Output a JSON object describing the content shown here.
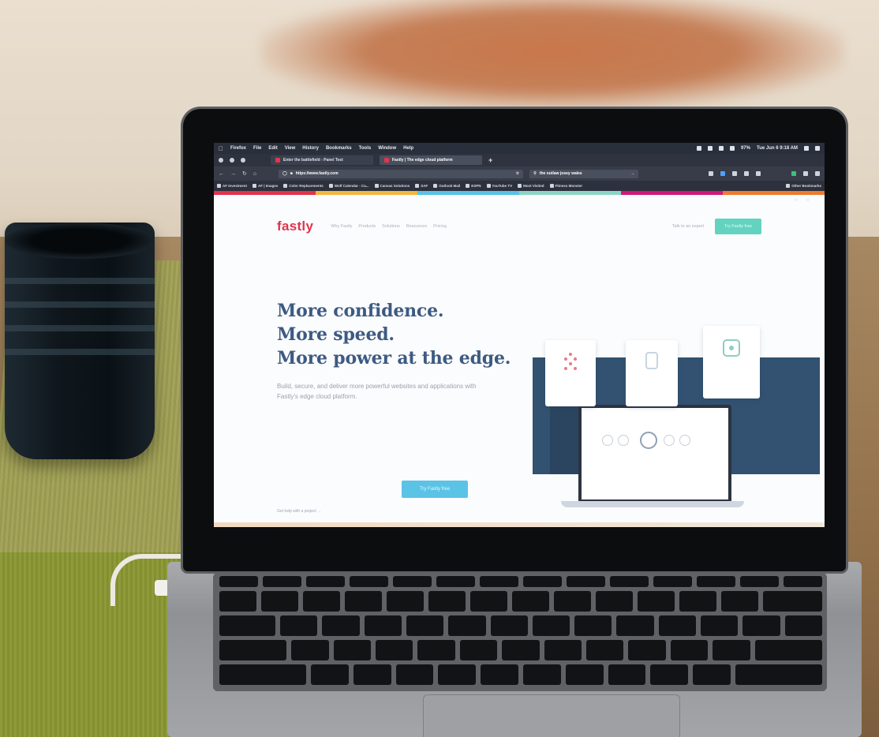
{
  "browser": {
    "menu": {
      "items": [
        "Firefox",
        "File",
        "Edit",
        "View",
        "History",
        "Bookmarks",
        "Tools",
        "Window",
        "Help"
      ],
      "battery": "97%",
      "clock": "Tue Jun 6 9:18 AM"
    },
    "tabs": [
      {
        "label": "Enter the battlefield - Panel Test",
        "active": false
      },
      {
        "label": "Fastly | The edge cloud platform",
        "active": true
      }
    ],
    "new_tab": "+",
    "url": "https://www.fastly.com",
    "search_value": "the outlaw josey wales",
    "bookmarks": [
      "AF Investment",
      "AF | Images",
      "Color Replacements",
      "Wolf Calendar - Ca...",
      "Canvas Solutions",
      "SAF",
      "Outlook Mail",
      "ESPN",
      "YouTube TV",
      "Most Visited",
      "Fitness Monster"
    ],
    "other_bookmarks": "Other Bookmarks"
  },
  "site": {
    "logo": "fastly",
    "nav": [
      "Why Fastly",
      "Products",
      "Solutions",
      "Resources",
      "Pricing"
    ],
    "talk_link": "Talk to an expert",
    "try_button": "Try Fastly free",
    "hero_lines": [
      "More confidence.",
      "More speed.",
      "More power at the edge."
    ],
    "hero_sub": "Build, secure, and deliver more powerful websites and applications with Fastly's edge cloud platform.",
    "hero_cta": "Try Fastly free",
    "hero_link": "Get help with a project  →",
    "brand_color": "#e0344d",
    "heading_color": "#3d5a82",
    "accent_colors": [
      "#e0344d",
      "#f4b63f",
      "#59c2e6",
      "#8dd6c5",
      "#d0197a",
      "#ee7b30"
    ]
  }
}
